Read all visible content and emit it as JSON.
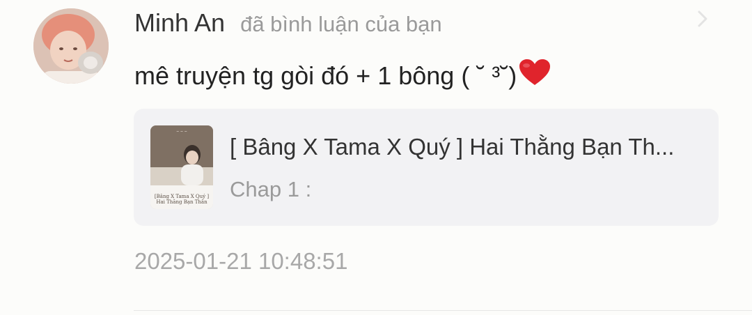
{
  "notification": {
    "user": {
      "name": "Minh An",
      "avatar_icon": "profile-photo"
    },
    "action_text": "đã bình luận của bạn",
    "comment_text": "mê truyện tg gòi đó + 1 bông ( ˘ ³˘)",
    "comment_emoji": "heart-emoji",
    "story": {
      "title": "[ Bâng X Tama X Quý ] Hai Thằng Bạn Th...",
      "chapter": "Chap 1 :",
      "cover_caption": "[Bâng X Tama X Quý ] Hai Thằng Bạn Thân"
    },
    "timestamp": "2025-01-21 10:48:51"
  },
  "colors": {
    "background": "#fcfcfa",
    "username": "#333333",
    "secondary_text": "#9a9a9a",
    "card_background": "#f2f2f4",
    "heart": "#e0242c"
  }
}
